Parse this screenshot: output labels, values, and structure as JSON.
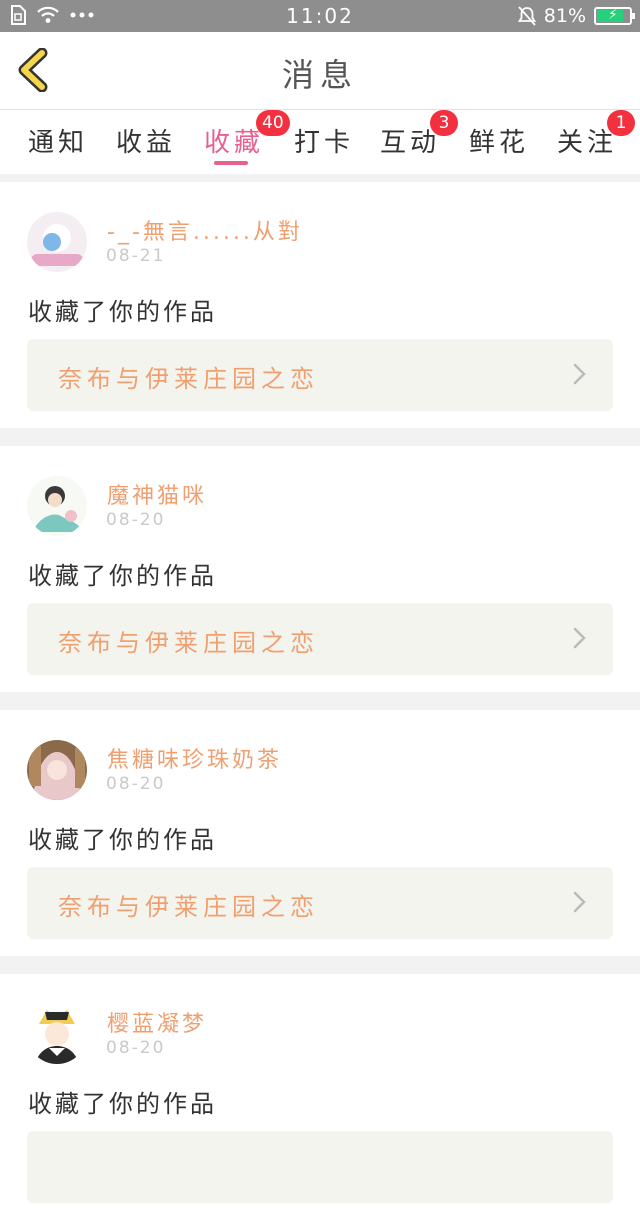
{
  "status_bar": {
    "time": "11:02",
    "battery": "81%",
    "battery_level": 0.81
  },
  "header": {
    "title": "消息"
  },
  "tabs": [
    {
      "label": "通知",
      "badge": ""
    },
    {
      "label": "收益",
      "badge": ""
    },
    {
      "label": "收藏",
      "badge": "40"
    },
    {
      "label": "打卡",
      "badge": ""
    },
    {
      "label": "互动",
      "badge": "3"
    },
    {
      "label": "鲜花",
      "badge": ""
    },
    {
      "label": "关注",
      "badge": "1"
    }
  ],
  "messages": [
    {
      "user": "-_-無言......从對",
      "date": "08-21",
      "action": "收藏了你的作品",
      "work": "奈布与伊莱庄园之恋"
    },
    {
      "user": "魔神猫咪",
      "date": "08-20",
      "action": "收藏了你的作品",
      "work": "奈布与伊莱庄园之恋"
    },
    {
      "user": "焦糖味珍珠奶茶",
      "date": "08-20",
      "action": "收藏了你的作品",
      "work": "奈布与伊莱庄园之恋"
    },
    {
      "user": "樱蓝凝梦",
      "date": "08-20",
      "action": "收藏了你的作品",
      "work": ""
    }
  ],
  "colors": {
    "accent": "#e8608f",
    "badge": "#f2303f",
    "username": "#f0a070",
    "back_arrow": "#f5d54a",
    "battery": "#27d07a"
  }
}
